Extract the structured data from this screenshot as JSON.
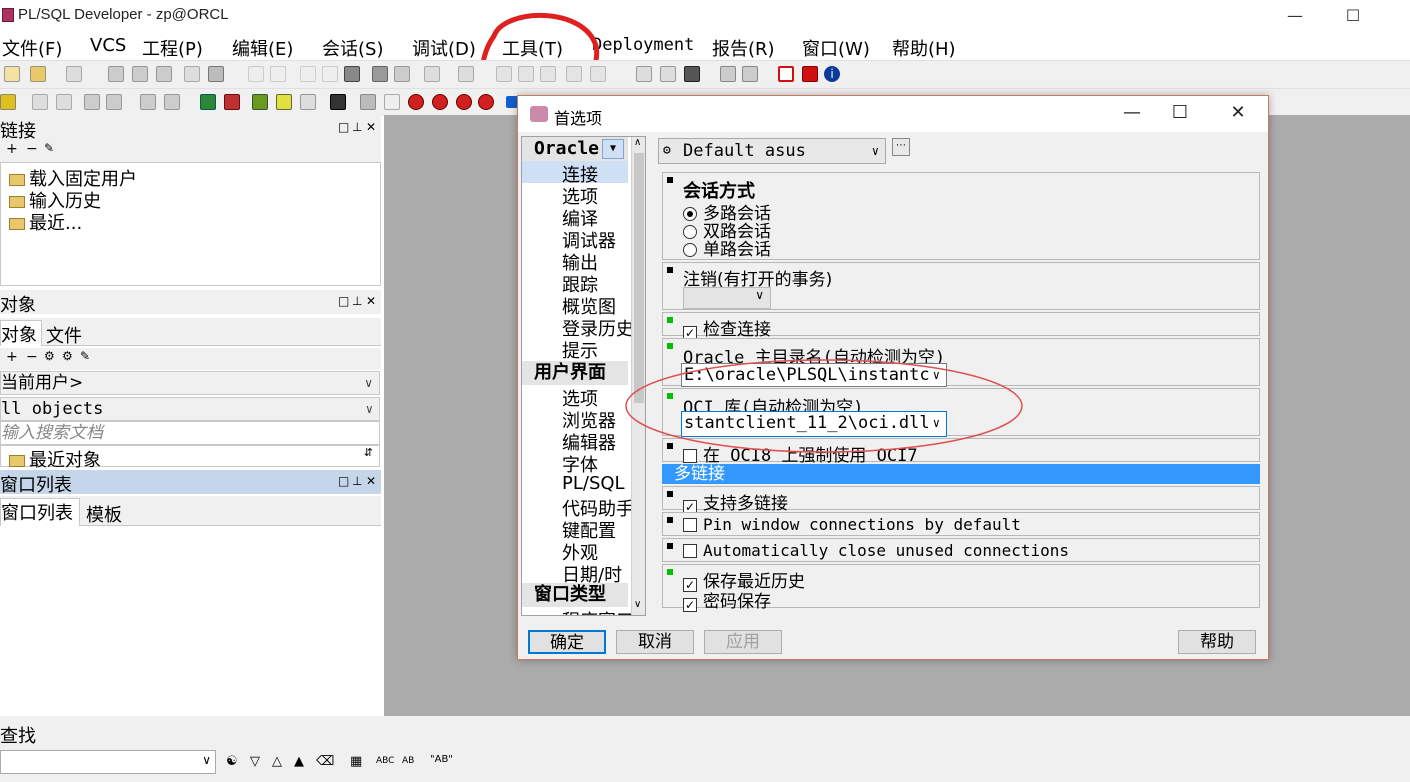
{
  "window": {
    "title": "PL/SQL Developer - zp@ORCL"
  },
  "menu": [
    "文件(F)",
    "VCS",
    "工程(P)",
    "编辑(E)",
    "会话(S)",
    "调试(D)",
    "工具(T)",
    "Deployment",
    "报告(R)",
    "窗口(W)",
    "帮助(H)"
  ],
  "connection_panel": {
    "title": "链接",
    "items": [
      "载入固定用户",
      "输入历史",
      "最近..."
    ]
  },
  "objects_panel": {
    "title": "对象",
    "tabs": [
      "对象",
      "文件"
    ],
    "user_combo": "当前用户>",
    "objects_combo": "ll objects",
    "search_placeholder": "输入搜索文档",
    "recent": "最近对象"
  },
  "window_list_panel": {
    "title": "窗口列表",
    "tabs": [
      "窗口列表",
      "模板"
    ]
  },
  "find_bar": {
    "label": "查找"
  },
  "dialog": {
    "title": "首选项",
    "categories": {
      "group1": "Oracle",
      "group1_items": [
        "连接",
        "选项",
        "编译",
        "调试器",
        "输出",
        "跟踪",
        "概览图",
        "登录历史",
        "提示"
      ],
      "group2": "用户界面",
      "group2_items": [
        "选项",
        "浏览器",
        "编辑器",
        "字体",
        "PL/SQL",
        "代码助手",
        "键配置",
        "外观",
        "日期/时"
      ],
      "group3": "窗口类型",
      "group3_items": [
        "程序窗口"
      ]
    },
    "profile": "Default asus",
    "session_mode": {
      "title": "会话方式",
      "options": [
        "多路会话",
        "双路会话",
        "单路会话"
      ]
    },
    "logoff": {
      "label": "注销(有打开的事务)"
    },
    "check_connection": "检查连接",
    "oracle_home": {
      "label": "Oracle 主目录名(自动检测为空)",
      "value": "E:\\oracle\\PLSQL\\instantc"
    },
    "oci_lib": {
      "label": "OCI 库(自动检测为空)",
      "value": "stantclient_11_2\\oci.dll"
    },
    "force_oci7": "在 OCI8 上强制使用 OCI7",
    "multi_conn_header": "多链接",
    "support_multi": "支持多链接",
    "pin_window": "Pin window connections by default",
    "auto_close": "Automatically close unused connections",
    "save_history": "保存最近历史",
    "save_password": "密码保存",
    "buttons": {
      "ok": "确定",
      "cancel": "取消",
      "apply": "应用",
      "help": "帮助"
    }
  }
}
